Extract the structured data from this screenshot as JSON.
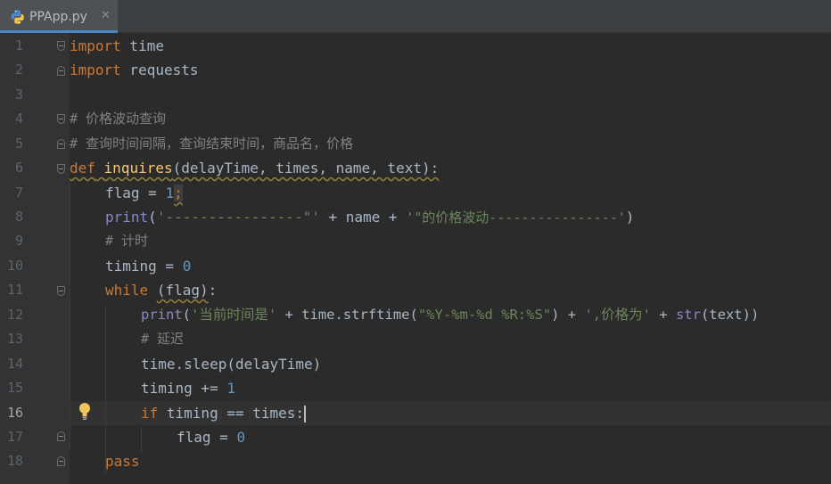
{
  "tab": {
    "filename": "PPApp.py",
    "close_glyph": "✕",
    "icon": "python-file-icon"
  },
  "editor": {
    "current_line": 16,
    "line_numbers": [
      "1",
      "2",
      "3",
      "4",
      "5",
      "6",
      "7",
      "8",
      "9",
      "10",
      "11",
      "12",
      "13",
      "14",
      "15",
      "16",
      "17",
      "18"
    ],
    "code": {
      "l1": {
        "kw": "import",
        "rest": " time"
      },
      "l2": {
        "kw": "import",
        "rest": " requests"
      },
      "l4": {
        "comment": "# 价格波动查询"
      },
      "l5": {
        "comment": "# 查询时间间隔，查询结束时间，商品名，价格"
      },
      "l6": {
        "kw": "def",
        "sp": " ",
        "fn": "inquires",
        "params": "(delayTime, times, name, text):"
      },
      "l7": {
        "a": "flag = ",
        "num": "1",
        "b": ";"
      },
      "l8": {
        "bi": "print",
        "a": "(",
        "s1": "'----------------\"'",
        "b": " + name + ",
        "s2": "'\"的价格波动----------------'",
        "c": ")"
      },
      "l9": {
        "comment": "# 计时"
      },
      "l10": {
        "a": "timing = ",
        "num": "0"
      },
      "l11": {
        "kw": "while",
        "sp": " ",
        "cond": "(flag)",
        "b": ":"
      },
      "l12": {
        "bi": "print",
        "a": "(",
        "s1": "'当前时间是'",
        "b": " + time.strftime(",
        "s2": "\"%Y-%m-%d %R:%S\"",
        "c": ") + ",
        "s3": "',价格为'",
        "d": " + ",
        "bi2": "str",
        "e": "(text))"
      },
      "l13": {
        "comment": "# 延迟"
      },
      "l14": {
        "a": "time.sleep(delayTime)"
      },
      "l15": {
        "a": "timing += ",
        "num": "1"
      },
      "l16": {
        "kw": "if",
        "a": " timing == times:"
      },
      "l17": {
        "a": "flag = ",
        "num": "0"
      },
      "l18": {
        "kw": "pass"
      }
    }
  },
  "colors": {
    "background": "#2b2b2b",
    "gutter": "#313335",
    "keyword": "#cc7832",
    "function": "#ffc66d",
    "number": "#6897bb",
    "string": "#6a8759",
    "comment": "#808080",
    "builtin": "#8888c6",
    "text": "#a9b7c6"
  }
}
